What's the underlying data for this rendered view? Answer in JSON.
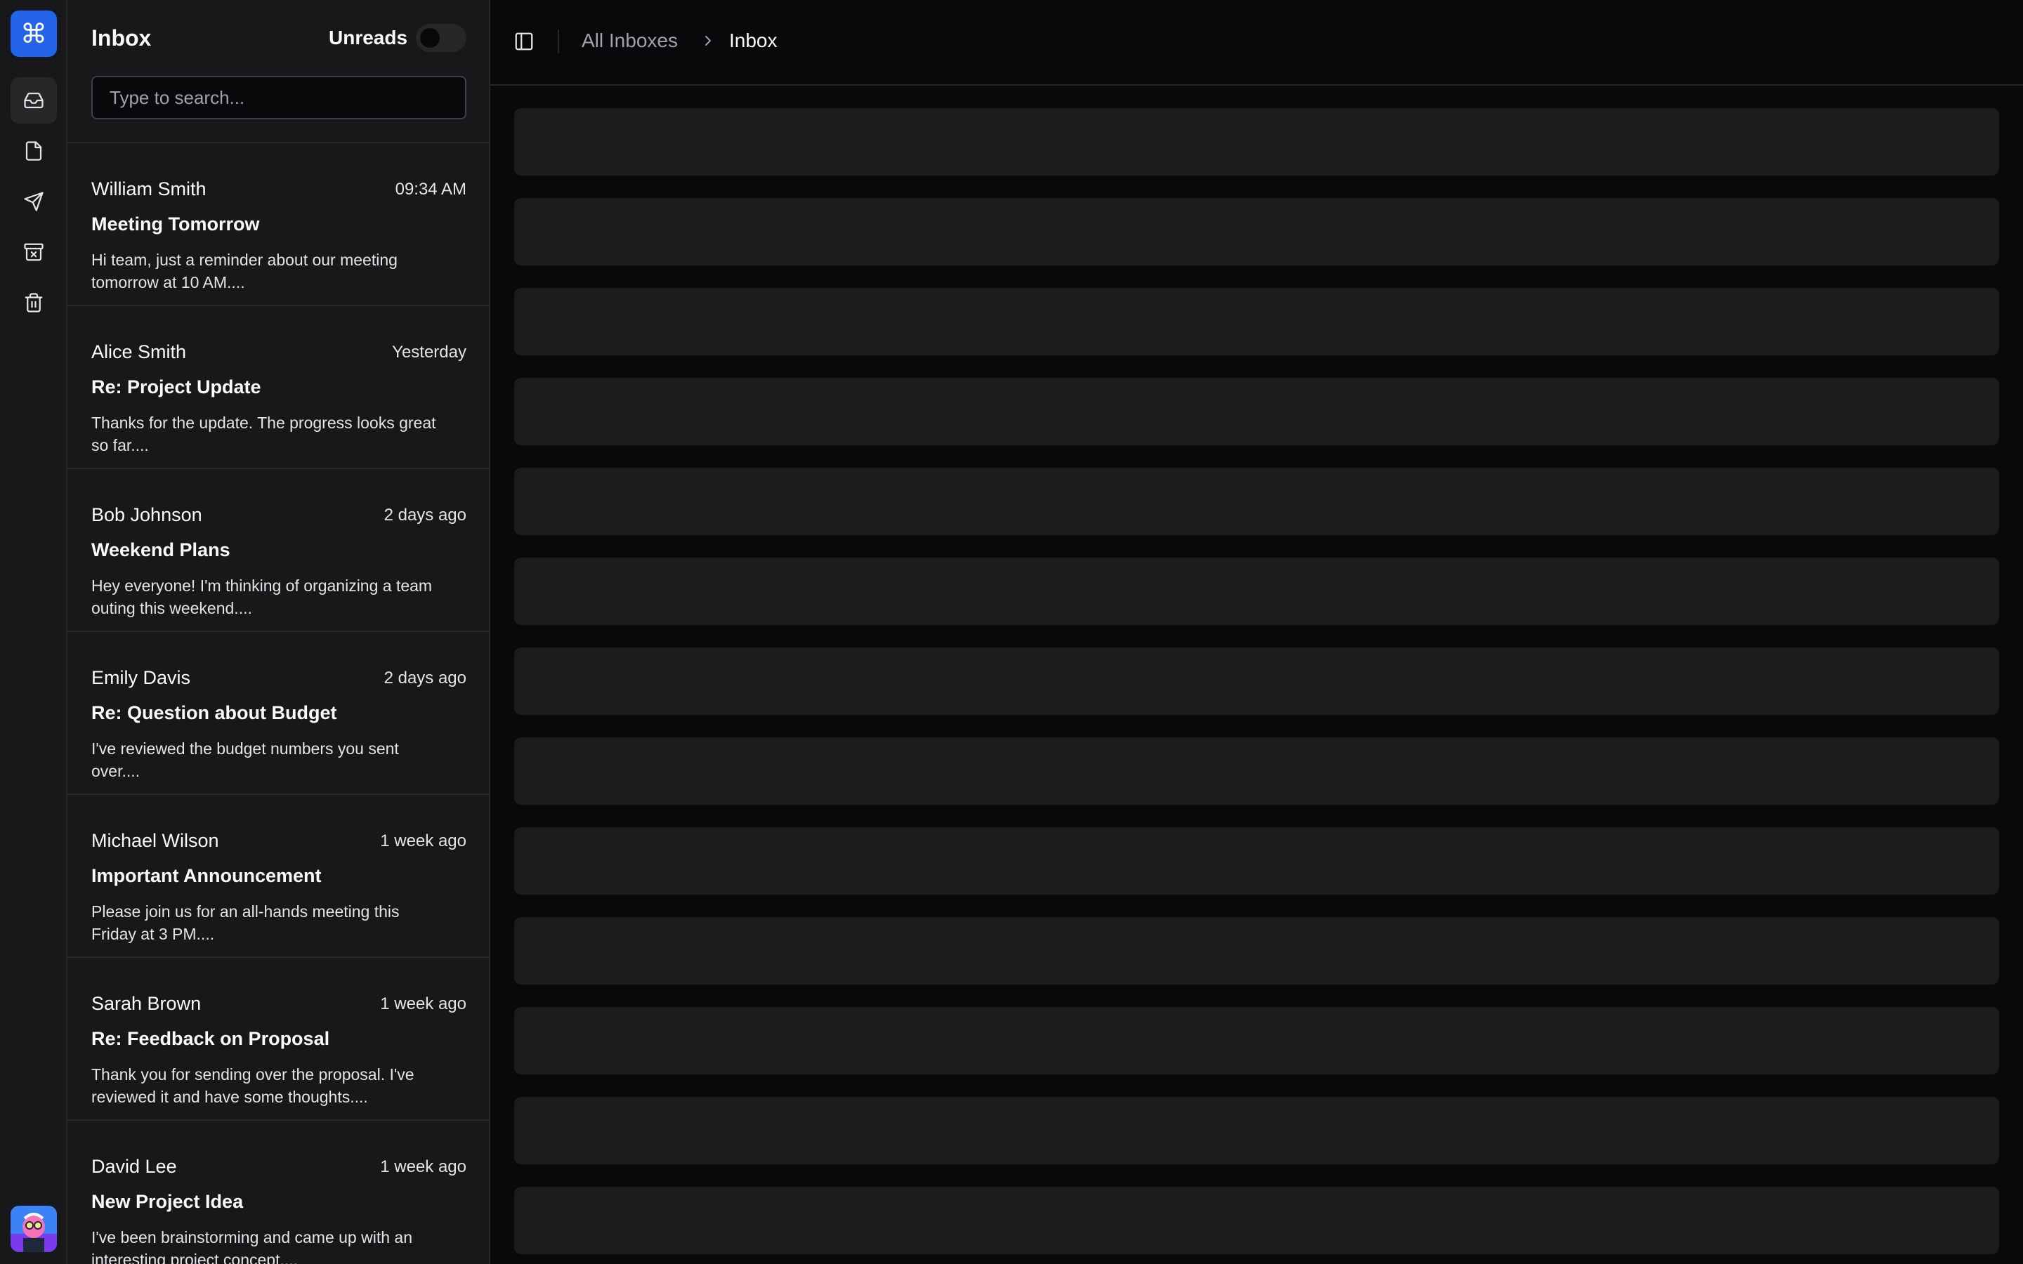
{
  "rail": {
    "logo_glyph": "⌘",
    "items": [
      {
        "name": "inbox-icon",
        "active": true
      },
      {
        "name": "drafts-icon",
        "active": false
      },
      {
        "name": "sent-icon",
        "active": false
      },
      {
        "name": "archive-icon",
        "active": false
      },
      {
        "name": "trash-icon",
        "active": false
      }
    ],
    "accent": "#2563eb"
  },
  "list": {
    "title": "Inbox",
    "unreads_label": "Unreads",
    "unreads_on": false,
    "search_placeholder": "Type to search...",
    "mails": [
      {
        "from": "William Smith",
        "time": "09:34 AM",
        "subject": "Meeting Tomorrow",
        "preview": "Hi team, just a reminder about our meeting tomorrow at 10 AM...."
      },
      {
        "from": "Alice Smith",
        "time": "Yesterday",
        "subject": "Re: Project Update",
        "preview": "Thanks for the update. The progress looks great so far...."
      },
      {
        "from": "Bob Johnson",
        "time": "2 days ago",
        "subject": "Weekend Plans",
        "preview": "Hey everyone! I'm thinking of organizing a team outing this weekend...."
      },
      {
        "from": "Emily Davis",
        "time": "2 days ago",
        "subject": "Re: Question about Budget",
        "preview": "I've reviewed the budget numbers you sent over...."
      },
      {
        "from": "Michael Wilson",
        "time": "1 week ago",
        "subject": "Important Announcement",
        "preview": "Please join us for an all-hands meeting this Friday at 3 PM...."
      },
      {
        "from": "Sarah Brown",
        "time": "1 week ago",
        "subject": "Re: Feedback on Proposal",
        "preview": "Thank you for sending over the proposal. I've reviewed it and have some thoughts...."
      },
      {
        "from": "David Lee",
        "time": "1 week ago",
        "subject": "New Project Idea",
        "preview": "I've been brainstorming and came up with an interesting project concept...."
      }
    ]
  },
  "main": {
    "breadcrumb": [
      "All Inboxes",
      "Inbox"
    ],
    "loading_rows": 13
  }
}
